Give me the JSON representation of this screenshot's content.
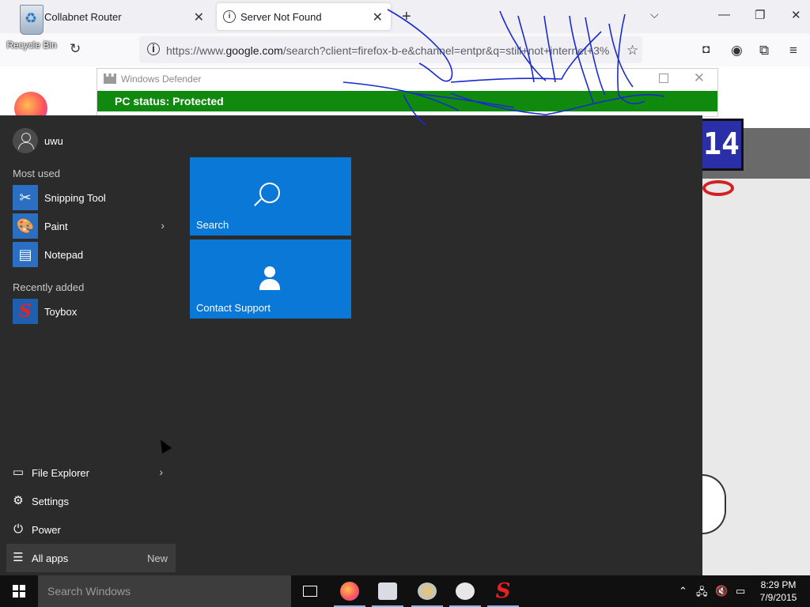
{
  "desktop": {
    "recycle_bin_label": "Recycle Bin"
  },
  "browser": {
    "tabs": [
      {
        "label": "Collabnet Router",
        "active": false
      },
      {
        "label": "Server Not Found",
        "active": true
      }
    ],
    "new_tab": "+",
    "url": {
      "prefix": "https://www.",
      "host": "google.com",
      "rest": "/search?client=firefox-b-e&channel=entpr&q=still+not+internet+3%"
    }
  },
  "defender": {
    "title": "Windows Defender",
    "status": "PC status: Protected",
    "status_color": "#108a0e"
  },
  "start_menu": {
    "user_name": "uwu",
    "most_used_label": "Most used",
    "most_used": [
      {
        "label": "Snipping Tool",
        "icon": "snipping-tool-icon"
      },
      {
        "label": "Paint",
        "icon": "paint-icon",
        "has_submenu": true
      },
      {
        "label": "Notepad",
        "icon": "notepad-icon"
      }
    ],
    "recently_added_label": "Recently added",
    "recently_added": [
      {
        "label": "Toybox",
        "icon": "toybox-icon"
      }
    ],
    "system": [
      {
        "label": "File Explorer",
        "icon": "folder-icon",
        "has_submenu": true
      },
      {
        "label": "Settings",
        "icon": "gear-icon"
      },
      {
        "label": "Power",
        "icon": "power-icon"
      },
      {
        "label": "All apps",
        "icon": "list-icon"
      }
    ],
    "new_badge": "New",
    "tiles": [
      {
        "label": "Search",
        "icon": "search-icon"
      },
      {
        "label": "Contact Support",
        "icon": "support-agent-icon"
      }
    ],
    "accent": "#0a78d7"
  },
  "taskbar": {
    "search_placeholder": "Search Windows",
    "clock_time": "8:29 PM",
    "clock_date": "7/9/2015"
  },
  "game": {
    "score": "14"
  }
}
